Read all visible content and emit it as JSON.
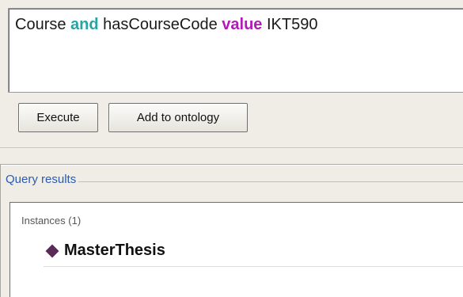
{
  "query_editor": {
    "tokens": [
      "Course",
      "and",
      "hasCourseCode",
      "value",
      "IKT590"
    ]
  },
  "buttons": {
    "execute_label": "Execute",
    "add_label": "Add to ontology"
  },
  "results": {
    "title": "Query results",
    "instances_label": "Instances (1)",
    "items": [
      {
        "name": "MasterThesis",
        "icon": "diamond-icon"
      }
    ]
  },
  "colors": {
    "keyword_and": "#29a3a6",
    "keyword_value": "#b01bb8",
    "results_title": "#2b5bb0",
    "individual_icon": "#5a2a58"
  }
}
